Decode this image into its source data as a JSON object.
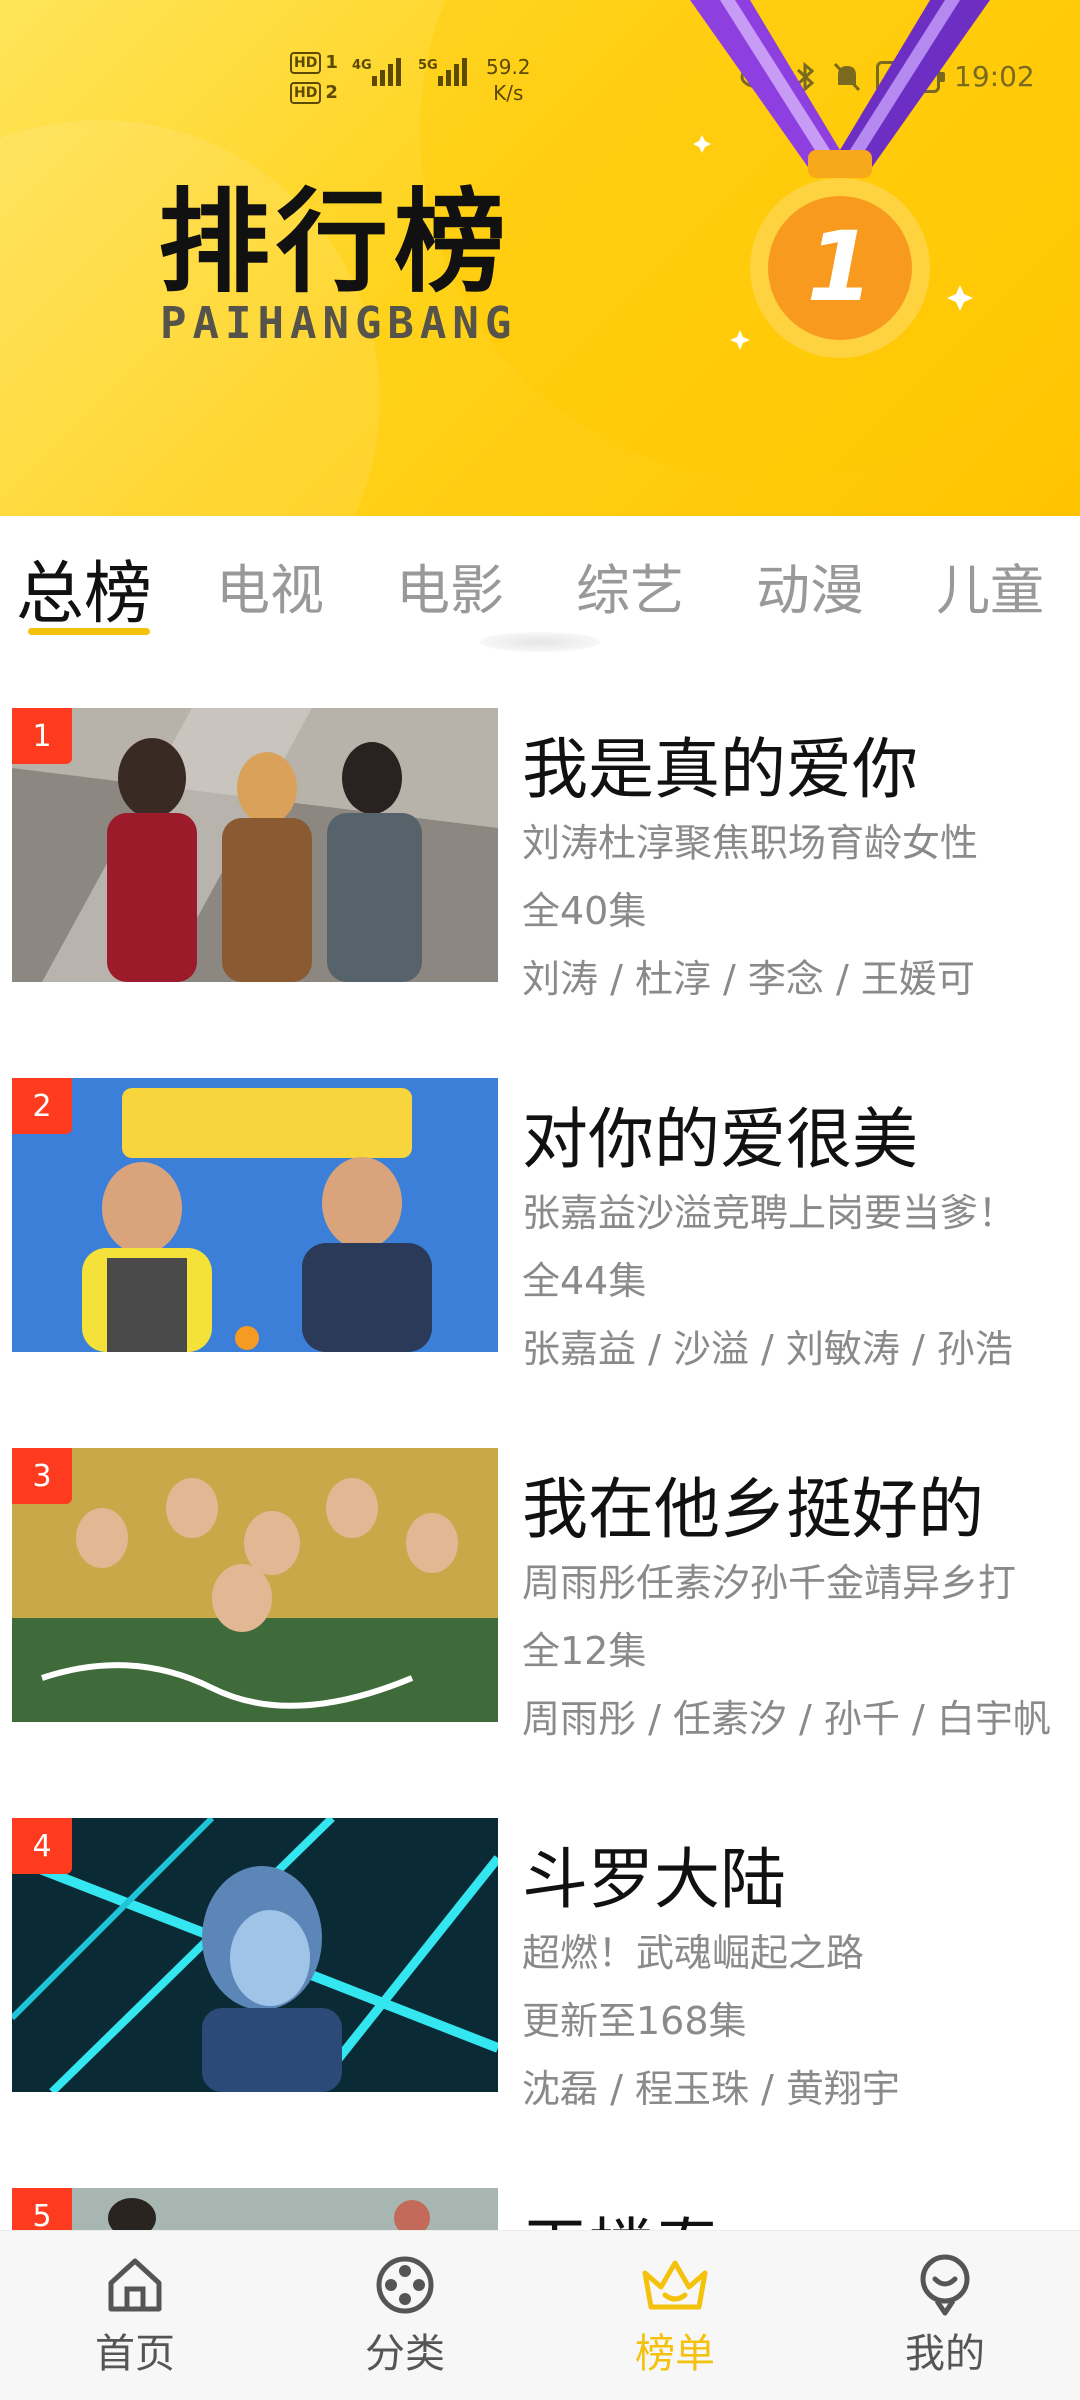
{
  "status_bar": {
    "hd1": "HD",
    "hd1_num": "1",
    "hd2": "HD",
    "hd2_num": "2",
    "net1": "4G",
    "net2": "5G",
    "speed_value": "59.2",
    "speed_unit": "K/s",
    "battery": "95",
    "time": "19:02"
  },
  "banner": {
    "title": "排行榜",
    "subtitle": "PAIHANGBANG",
    "medal_number": "1",
    "colors": {
      "primary": "#ffd21a",
      "accent_purple": "#7a3bd1"
    }
  },
  "tabs": [
    {
      "label": "总榜",
      "active": true
    },
    {
      "label": "电视"
    },
    {
      "label": "电影"
    },
    {
      "label": "综艺"
    },
    {
      "label": "动漫"
    },
    {
      "label": "儿童"
    }
  ],
  "items": [
    {
      "rank": "1",
      "title": "我是真的爱你",
      "desc": "刘涛杜淳聚焦职场育龄女性",
      "episodes": "全40集",
      "cast": "刘涛 / 杜淳 / 李念 / 王媛可"
    },
    {
      "rank": "2",
      "title": "对你的爱很美",
      "desc": "张嘉益沙溢竞聘上岗要当爹！",
      "episodes": "全44集",
      "cast": "张嘉益 / 沙溢 / 刘敏涛 / 孙浩"
    },
    {
      "rank": "3",
      "title": "我在他乡挺好的",
      "desc": "周雨彤任素汐孙千金靖异乡打",
      "episodes": "全12集",
      "cast": "周雨彤 / 任素汐 / 孙千 / 白宇帆"
    },
    {
      "rank": "4",
      "title": "斗罗大陆",
      "desc": "超燃！武魂崛起之路",
      "episodes": "更新至168集",
      "cast": "沈磊 / 程玉珠 / 黄翔宇"
    },
    {
      "rank": "5",
      "title": "玉楼春",
      "desc": "",
      "episodes": "",
      "cast": ""
    }
  ],
  "bottom_nav": [
    {
      "label": "首页",
      "icon": "home-icon"
    },
    {
      "label": "分类",
      "icon": "film-reel-icon"
    },
    {
      "label": "榜单",
      "icon": "crown-icon",
      "active": true
    },
    {
      "label": "我的",
      "icon": "user-icon"
    }
  ],
  "colors": {
    "rank_badge": "#ff3b1f",
    "active_accent": "#f4c20d"
  }
}
